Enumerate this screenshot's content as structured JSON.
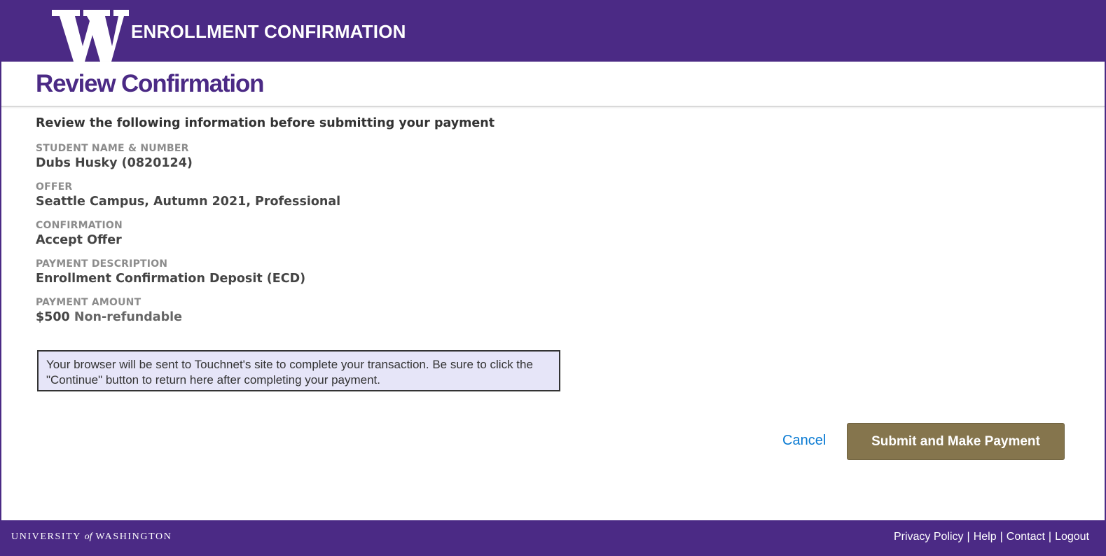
{
  "header": {
    "logo_name": "uw-w-logo",
    "title": "ENROLLMENT CONFIRMATION"
  },
  "page": {
    "title": "Review Confirmation",
    "intro": "Review the following information before submitting your payment"
  },
  "fields": {
    "student": {
      "label": "STUDENT NAME & NUMBER",
      "value": "Dubs Husky (0820124)"
    },
    "offer": {
      "label": "OFFER",
      "value": "Seattle Campus, Autumn 2021, Professional"
    },
    "confirmation": {
      "label": "CONFIRMATION",
      "value": "Accept Offer"
    },
    "payment_description": {
      "label": "PAYMENT DESCRIPTION",
      "value": "Enrollment Confirmation Deposit (ECD)"
    },
    "payment_amount": {
      "label": "PAYMENT AMOUNT",
      "amount": "$500",
      "note": "Non-refundable"
    }
  },
  "notice": "Your browser will be sent to Touchnet's site to complete your transaction. Be sure to click the \"Continue\" button to return here after completing your payment.",
  "actions": {
    "cancel_label": "Cancel",
    "submit_label": "Submit and Make Payment"
  },
  "footer": {
    "wordmark_left": "UNIVERSITY",
    "wordmark_of": "of",
    "wordmark_right": "WASHINGTON",
    "links": [
      "Privacy Policy",
      "Help",
      "Contact",
      "Logout"
    ],
    "separator": "|"
  },
  "colors": {
    "brand_purple": "#4b2a85",
    "gold_button": "#85754d",
    "link_blue": "#0a7bd3",
    "notice_bg": "#e6e5f8"
  }
}
